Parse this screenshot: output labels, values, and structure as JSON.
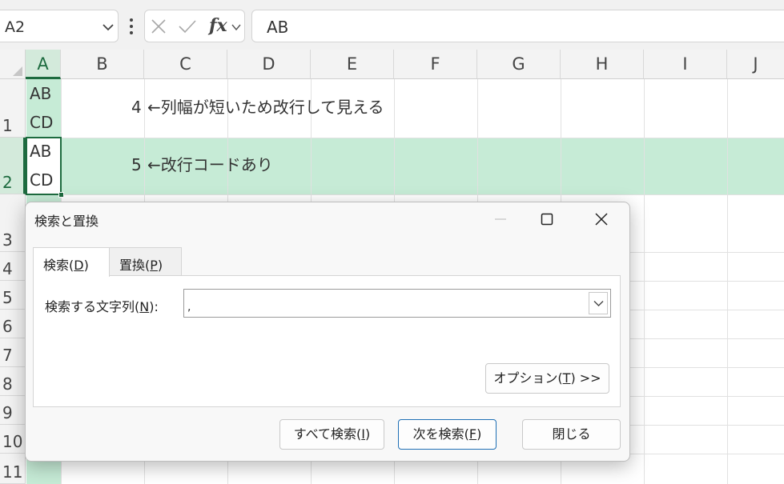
{
  "formula_bar": {
    "name_box": "A2",
    "fx_label": "fx",
    "formula": "AB"
  },
  "sheet": {
    "columns": [
      "A",
      "B",
      "C",
      "D",
      "E",
      "F",
      "G",
      "H",
      "I",
      "J"
    ],
    "rows": [
      "1",
      "2",
      "3",
      "4",
      "5",
      "6",
      "7",
      "8",
      "9",
      "10",
      "11"
    ],
    "cells": {
      "A1_line1": "AB",
      "A1_line2": "CD",
      "B1": "4",
      "C1": "←列幅が短いため改行して見える",
      "A2_line1": "AB",
      "A2_line2": "CD",
      "B2": "5",
      "C2": "←改行コードあり"
    },
    "selection_color": "#c6ebd6",
    "accent_color": "#1d6b3f"
  },
  "dialog": {
    "title": "検索と置換",
    "tabs": [
      {
        "label": "検索(",
        "key": "D",
        "suffix": ")"
      },
      {
        "label": "置換(",
        "key": "P",
        "suffix": ")"
      }
    ],
    "find_label": {
      "text": "検索する文字列(",
      "key": "N",
      "suffix": "):"
    },
    "find_value": ",",
    "options_button": {
      "text": "オプション(",
      "key": "T",
      "suffix": ") >>"
    },
    "find_all_button": {
      "text": "すべて検索(",
      "key": "I",
      "suffix": ")"
    },
    "find_next_button": {
      "text": "次を検索(",
      "key": "F",
      "suffix": ")"
    },
    "close_button": "閉じる"
  }
}
